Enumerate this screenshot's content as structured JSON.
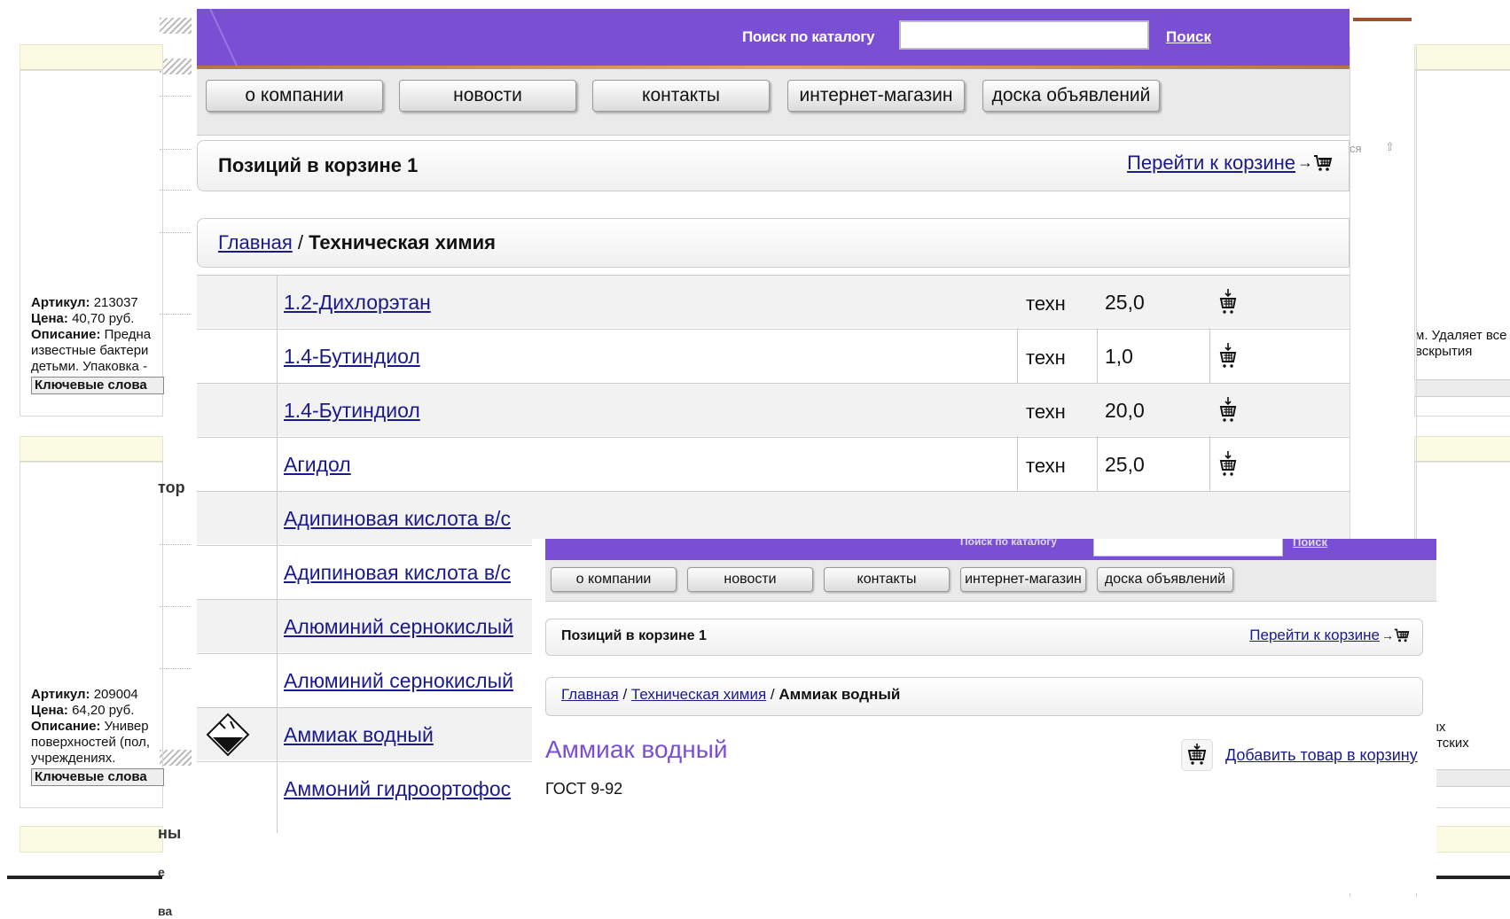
{
  "background": {
    "items": [
      {
        "article_label": "Артикул:",
        "article": "213037",
        "price_label": "Цена:",
        "price": "40,70 руб.",
        "desc_label": "Описание:",
        "desc": "Предна",
        "desc_lines": [
          "известные бактери",
          "детьми. Упаковка -"
        ],
        "keywords_label": "Ключевые слова"
      },
      {
        "article_label": "Артикул:",
        "article": "209004",
        "price_label": "Цена:",
        "price": "64,20 руб.",
        "desc_label": "Описание:",
        "desc": "Универ",
        "desc_lines": [
          "поверхностей (пол,",
          "учреждениях."
        ],
        "keywords_label": "Ключевые слова"
      }
    ],
    "side_labels": [
      "тор",
      "ны",
      "е",
      "ва"
    ],
    "right_texts": [
      "м. Удаляет все",
      "вскрытия",
      "чных",
      "і детских"
    ],
    "right_top_text": "ся"
  },
  "header": {
    "search_label": "Поиск по каталогу",
    "search_value": "",
    "search_button": "Поиск"
  },
  "nav": [
    "о компании",
    "новости",
    "контакты",
    "интернет-магазин",
    "доска объявлений"
  ],
  "cart": {
    "count_text": "Позиций в корзине 1",
    "link_text": "Перейти к корзине",
    "arrow": "→",
    "icon": "cart-icon"
  },
  "breadcrumb": {
    "home": "Главная",
    "separator": " / ",
    "current": "Техническая химия"
  },
  "products": [
    {
      "name": "1.2-Дихлорэтан",
      "grade": "техн",
      "qty": "25,0",
      "hazard": false
    },
    {
      "name": "1.4-Бутиндиол",
      "grade": "техн",
      "qty": "1,0",
      "hazard": false
    },
    {
      "name": "1.4-Бутиндиол",
      "grade": "техн",
      "qty": "20,0",
      "hazard": false
    },
    {
      "name": "Агидол",
      "grade": "техн",
      "qty": "25,0",
      "hazard": false
    },
    {
      "name": "Адипиновая кислота в/с",
      "grade": "",
      "qty": "",
      "hazard": false
    },
    {
      "name": "Адипиновая кислота в/с",
      "grade": "",
      "qty": "",
      "hazard": false
    },
    {
      "name": "Алюминий сернокислый",
      "grade": "",
      "qty": "",
      "hazard": false
    },
    {
      "name": "Алюминий сернокислый",
      "grade": "",
      "qty": "",
      "hazard": false
    },
    {
      "name": "Аммиак водный",
      "grade": "",
      "qty": "",
      "hazard": true
    },
    {
      "name": "Аммоний гидроортофос",
      "grade": "",
      "qty": "",
      "hazard": false
    }
  ],
  "overlay": {
    "search_label": "Поиск по каталогу",
    "search_button": "Поиск",
    "nav": [
      "о компании",
      "новости",
      "контакты",
      "интернет-магазин",
      "доска объявлений"
    ],
    "cart_count_text": "Позиций в корзине 1",
    "cart_link_text": "Перейти к корзине",
    "cart_arrow": "→",
    "breadcrumb": {
      "home": "Главная",
      "sep1": " / ",
      "category": "Техническая химия",
      "sep2": " / ",
      "current": "Аммиак водный"
    },
    "product_title": "Аммиак водный",
    "gost": "ГОСТ 9-92",
    "add_to_cart": "Добавить товар в корзину"
  },
  "colors": {
    "header_purple": "#7a4fd4",
    "link_blue": "#1a1a8c",
    "accent_orange": "#e8a460"
  }
}
